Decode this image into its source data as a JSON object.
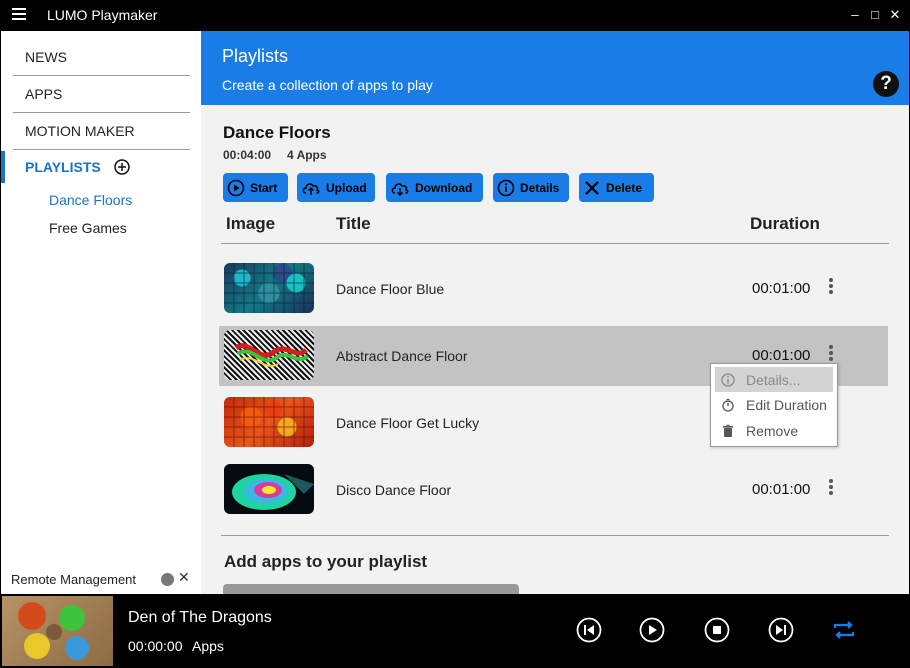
{
  "window": {
    "title": "LUMO Playmaker",
    "minimize": "–",
    "maximize": "□",
    "close": "✕"
  },
  "sidebar": {
    "nav": [
      {
        "label": "NEWS"
      },
      {
        "label": "APPS"
      },
      {
        "label": "MOTION MAKER"
      },
      {
        "label": "PLAYLISTS"
      }
    ],
    "playlists": [
      {
        "label": "Dance Floors",
        "selected": true
      },
      {
        "label": "Free Games",
        "selected": false
      }
    ],
    "remote_label": "Remote Management"
  },
  "banner": {
    "title": "Playlists",
    "subtitle": "Create a collection of apps to play",
    "help_label": "?"
  },
  "playlist": {
    "name": "Dance Floors",
    "duration": "00:04:00",
    "app_count": "4 Apps",
    "buttons": {
      "start": "Start",
      "upload": "Upload",
      "download": "Download",
      "details": "Details",
      "delete": "Delete"
    }
  },
  "table": {
    "headers": {
      "image": "Image",
      "title": "Title",
      "duration": "Duration"
    },
    "rows": [
      {
        "title": "Dance Floor Blue",
        "duration": "00:01:00"
      },
      {
        "title": "Abstract Dance Floor",
        "duration": "00:01:00"
      },
      {
        "title": "Dance Floor Get Lucky",
        "duration": ""
      },
      {
        "title": "Disco Dance Floor",
        "duration": "00:01:00"
      }
    ]
  },
  "context_menu": {
    "items": [
      {
        "label": "Details...",
        "icon": "info-icon"
      },
      {
        "label": "Edit Duration",
        "icon": "stopwatch-icon"
      },
      {
        "label": "Remove",
        "icon": "trash-icon"
      }
    ]
  },
  "add_section": {
    "title": "Add apps to your playlist"
  },
  "player": {
    "title": "Den of The Dragons",
    "time": "00:00:00",
    "type": "Apps"
  },
  "colors": {
    "accent": "#1a7ce6",
    "sidebar_active": "#1a73c8",
    "row_highlight": "#c3c3c3"
  }
}
